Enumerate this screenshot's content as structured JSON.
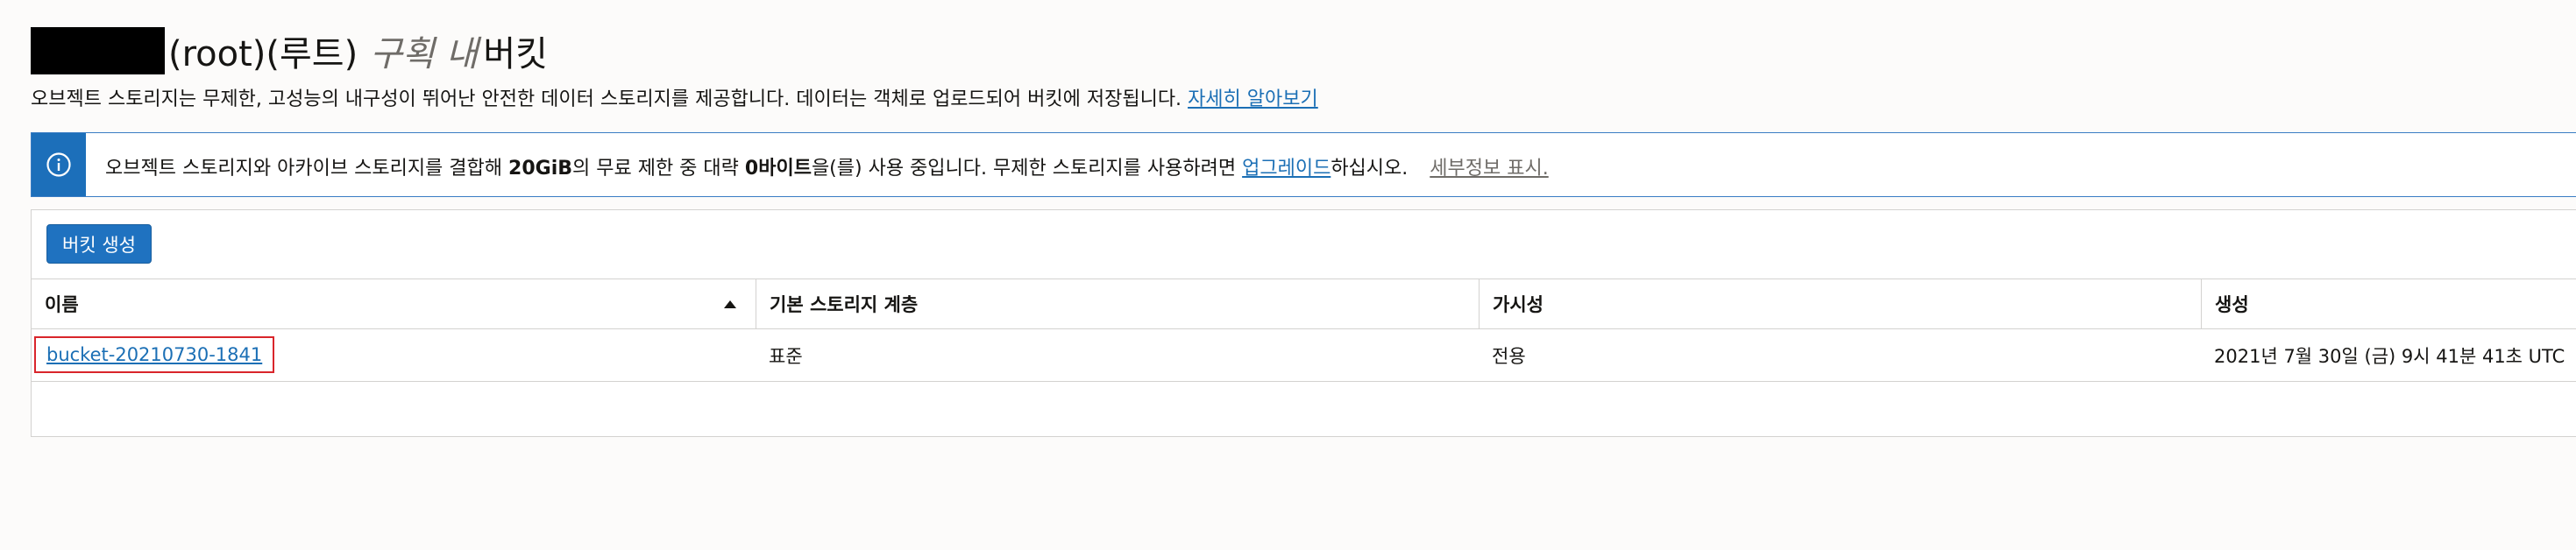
{
  "header": {
    "title_root": "(root)(루트)",
    "title_italic": "구획 내",
    "title_tail": "버킷",
    "description": "오브젝트 스토리지는 무제한, 고성능의 내구성이 뛰어난 안전한 데이터 스토리지를 제공합니다. 데이터는 객체로 업로드되어 버킷에 저장됩니다.",
    "learn_more_link": "자세히 알아보기"
  },
  "banner": {
    "icon": "info-icon",
    "text_pre": "오브젝트 스토리지와 아카이브 스토리지를 결합해",
    "free_limit": "20GiB",
    "text_mid": "의 무료 제한 중 대략",
    "used_amount": "0바이트",
    "text_post": "을(를) 사용 중입니다. 무제한 스토리지를 사용하려면",
    "upgrade_link": "업그레이드",
    "text_end": "하십시오.",
    "details_link": "세부정보 표시."
  },
  "toolbar": {
    "create_button": "버킷 생성"
  },
  "table": {
    "columns": [
      "이름",
      "기본 스토리지 계층",
      "가시성",
      "생성"
    ],
    "sort_icon": "sort-ascending-icon",
    "rows": [
      {
        "name": "bucket-20210730-1841",
        "tier": "표준",
        "visibility": "전용",
        "created": "2021년 7월 30일 (금) 9시 41분 41초 UTC"
      }
    ]
  },
  "colors": {
    "primary": "#1f72c0",
    "link": "#1b6fb5",
    "highlight": "#d9252b"
  }
}
